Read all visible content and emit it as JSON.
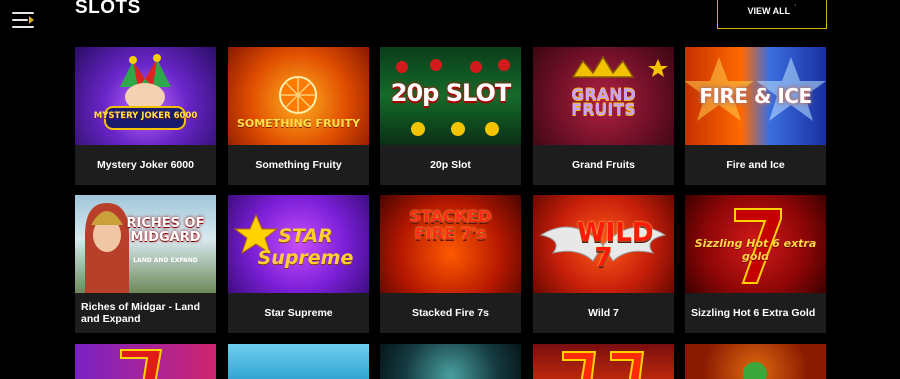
{
  "header": {
    "title": "SLOTS",
    "view_all": "VIEW ALL",
    "view_all_mark": "˙"
  },
  "games": [
    {
      "name": "Mystery Joker 6000",
      "logo": "MYSTERY JOKER 6000"
    },
    {
      "name": "Something Fruity",
      "logo": "SOMETHING FRUITY"
    },
    {
      "name": "20p Slot",
      "logo": "20p SLOT"
    },
    {
      "name": "Grand Fruits",
      "logo": "GRAND FRUITS"
    },
    {
      "name": "Fire and Ice",
      "logo": "FIRE & ICE"
    },
    {
      "name": "Riches of Midgar - Land and Expand",
      "logo": "RICHES OF MIDGARD",
      "logo_sub": "LAND AND EXPAND"
    },
    {
      "name": "Star Supreme",
      "logo": "STAR Supreme"
    },
    {
      "name": "Stacked Fire 7s",
      "logo": "STACKED FIRE 7's"
    },
    {
      "name": "Wild 7",
      "logo": "WILD 7"
    },
    {
      "name": "Sizzling Hot 6 Extra Gold",
      "logo": "Sizzling Hot 6 extra gold"
    }
  ],
  "colors": {
    "accent": "#d3b500",
    "tile_bg": "#1d1d1d",
    "page_bg": "#000000"
  }
}
